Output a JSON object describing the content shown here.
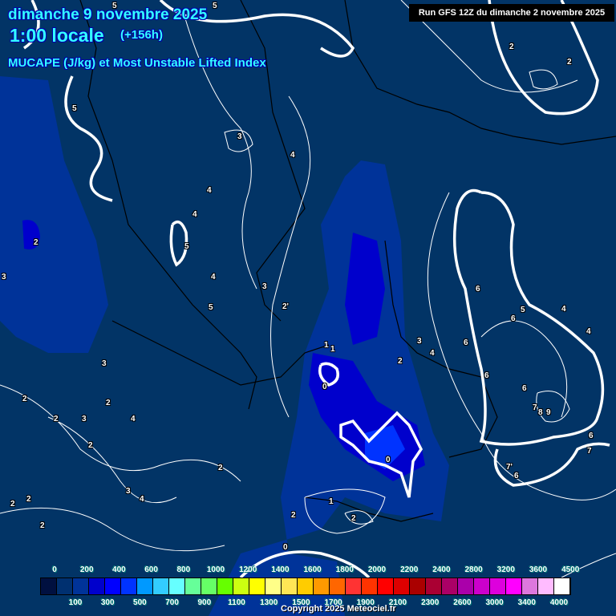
{
  "header": {
    "date": "dimanche 9 novembre 2025",
    "time": "1:00 locale",
    "lead": "(+156h)",
    "product": "MUCAPE (J/kg) et Most Unstable Lifted Index",
    "run": "Run GFS 12Z du dimanche 2 novembre 2025"
  },
  "colors": {
    "background": "#023466",
    "cape_low": "#003399",
    "cape_mid": "#0000cc",
    "cape_high": "#0033ff",
    "title": "#33ffff"
  },
  "colorbar": {
    "unit": "J/kg",
    "top_ticks": [
      "0",
      "200",
      "400",
      "600",
      "800",
      "1000",
      "1200",
      "1400",
      "1600",
      "1800",
      "2000",
      "2200",
      "2400",
      "2800",
      "3200",
      "3600",
      "4500"
    ],
    "bottom_ticks": [
      "100",
      "300",
      "500",
      "700",
      "900",
      "1100",
      "1300",
      "1500",
      "1700",
      "1900",
      "2100",
      "2300",
      "2600",
      "3000",
      "3400",
      "4000"
    ],
    "colors": [
      "#001040",
      "#003070",
      "#003399",
      "#0000cc",
      "#0000ff",
      "#0033ff",
      "#0099ff",
      "#33ccff",
      "#66ffff",
      "#66ff99",
      "#66ff66",
      "#66ff00",
      "#ccff11",
      "#ffff00",
      "#ffff88",
      "#ffe655",
      "#ffcc00",
      "#ff9900",
      "#ff6600",
      "#ff3333",
      "#ff3300",
      "#ff0000",
      "#dd0000",
      "#aa0000",
      "#aa0033",
      "#aa0066",
      "#aa00aa",
      "#cc00cc",
      "#dd00dd",
      "#ff00ff",
      "#dd77dd",
      "#ffbbff",
      "#ffffff"
    ]
  },
  "contour_labels": [
    "5",
    "5",
    "5",
    "3",
    "4",
    "4",
    "4",
    "5",
    "4",
    "5",
    "2",
    "3",
    "3",
    "2",
    "2",
    "3",
    "4",
    "2",
    "2",
    "3",
    "4",
    "2",
    "2",
    "2",
    "3",
    "2'",
    "1",
    "1",
    "0",
    "0",
    "3",
    "4",
    "2",
    "2",
    "1",
    "2",
    "2",
    "0",
    "6",
    "5",
    "4",
    "6",
    "6",
    "6",
    "4",
    "6",
    "7",
    "8",
    "9",
    "6",
    "7",
    "7'",
    "6",
    "2",
    "2"
  ],
  "copyright": "Copyright 2025 Meteociel.fr"
}
